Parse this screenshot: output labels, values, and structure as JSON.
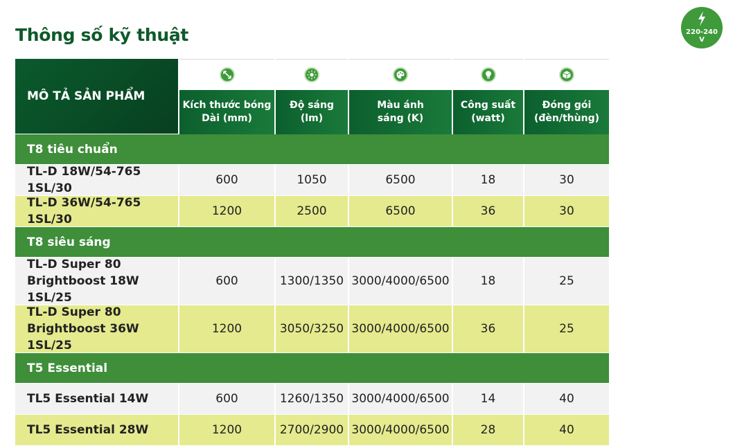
{
  "title": "Thông số kỹ thuật",
  "voltage_badge": {
    "text": "220-240\nV",
    "icon": "lightning-bolt-icon"
  },
  "table": {
    "description_header": "MÔ TẢ SẢN PHẨM",
    "columns": [
      {
        "label": "Kích thước bóng\nDài (mm)",
        "icon": "dimension-arrows-icon"
      },
      {
        "label": "Độ sáng\n(lm)",
        "icon": "brightness-sun-icon"
      },
      {
        "label": "Màu ánh\nsáng (K)",
        "icon": "color-palette-icon"
      },
      {
        "label": "Công suất\n(watt)",
        "icon": "light-bulb-icon"
      },
      {
        "label": "Đóng gói\n(đèn/thùng)",
        "icon": "package-box-icon"
      }
    ],
    "sections": [
      {
        "name": "T8 tiêu chuẩn",
        "rows": [
          {
            "name": "TL-D 18W/54-765 1SL/30",
            "values": [
              "600",
              "1050",
              "6500",
              "18",
              "30"
            ]
          },
          {
            "name": "TL-D 36W/54-765 1SL/30",
            "values": [
              "1200",
              "2500",
              "6500",
              "36",
              "30"
            ]
          }
        ]
      },
      {
        "name": "T8 siêu sáng",
        "rows": [
          {
            "name": "TL-D Super 80\nBrightboost 18W 1SL/25",
            "values": [
              "600",
              "1300/1350",
              "3000/4000/6500",
              "18",
              "25"
            ]
          },
          {
            "name": "TL-D Super 80\nBrightboost 36W 1SL/25",
            "values": [
              "1200",
              "3050/3250",
              "3000/4000/6500",
              "36",
              "25"
            ]
          }
        ]
      },
      {
        "name": "T5 Essential",
        "rows": [
          {
            "name": "TL5 Essential 14W",
            "values": [
              "600",
              "1260/1350",
              "3000/4000/6500",
              "14",
              "40"
            ]
          },
          {
            "name": "TL5 Essential 28W",
            "values": [
              "1200",
              "2700/2900",
              "3000/4000/6500",
              "28",
              "40"
            ]
          }
        ]
      }
    ]
  },
  "colors": {
    "dark_green": "#0a5a2c",
    "section_green": "#3e8e3a",
    "row_light": "#f2f2f2",
    "row_yellow": "#e5ea8e",
    "title_green": "#0e5a2a"
  }
}
